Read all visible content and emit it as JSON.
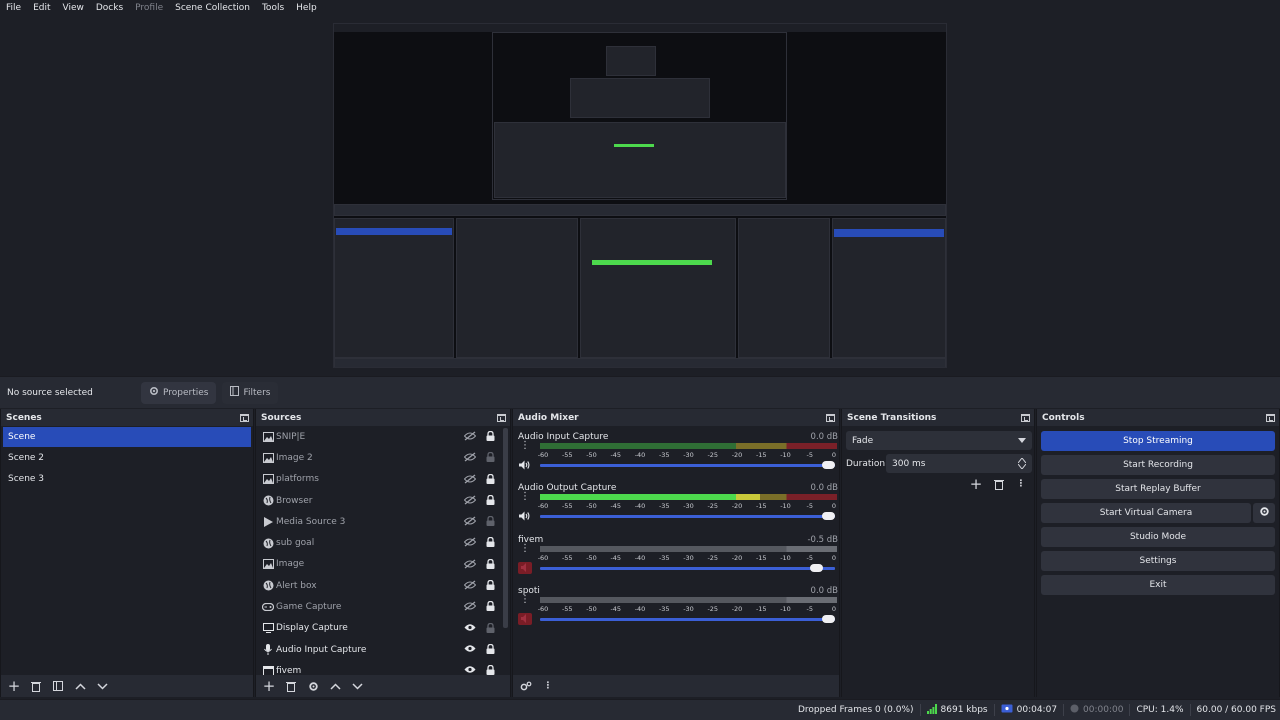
{
  "menu": [
    "File",
    "Edit",
    "View",
    "Docks",
    "Profile",
    "Scene Collection",
    "Tools",
    "Help"
  ],
  "menu_disabled": [
    "Profile"
  ],
  "context": {
    "no_source": "No source selected",
    "properties": "Properties",
    "filters": "Filters"
  },
  "scenes": {
    "title": "Scenes",
    "items": [
      "Scene",
      "Scene 2",
      "Scene 3"
    ],
    "selected": 0
  },
  "sources": {
    "title": "Sources",
    "items": [
      {
        "label": "SNIP|E",
        "icon": "image-icon",
        "visible": false,
        "locked": true
      },
      {
        "label": "Image 2",
        "icon": "image-icon",
        "visible": false,
        "locked": false
      },
      {
        "label": "platforms",
        "icon": "image-icon",
        "visible": false,
        "locked": true
      },
      {
        "label": "Browser",
        "icon": "globe-icon",
        "visible": false,
        "locked": true
      },
      {
        "label": "Media Source 3",
        "icon": "play-icon",
        "visible": false,
        "locked": false
      },
      {
        "label": "sub goal",
        "icon": "globe-icon",
        "visible": false,
        "locked": true
      },
      {
        "label": "Image",
        "icon": "image-icon",
        "visible": false,
        "locked": true
      },
      {
        "label": "Alert box",
        "icon": "globe-icon",
        "visible": false,
        "locked": true
      },
      {
        "label": "Game Capture",
        "icon": "gamepad-icon",
        "visible": false,
        "locked": true
      },
      {
        "label": "Display Capture",
        "icon": "monitor-icon",
        "visible": true,
        "locked": false
      },
      {
        "label": "Audio Input Capture",
        "icon": "microphone-icon",
        "visible": true,
        "locked": true
      },
      {
        "label": "fivem",
        "icon": "window-icon",
        "visible": true,
        "locked": true
      }
    ]
  },
  "mixer": {
    "title": "Audio Mixer",
    "tick_labels": [
      "-60",
      "-55",
      "-50",
      "-45",
      "-40",
      "-35",
      "-30",
      "-25",
      "-20",
      "-15",
      "-10",
      "-5",
      "0"
    ],
    "channels": [
      {
        "name": "Audio Input Capture",
        "db": "0.0 dB",
        "level": 0.0,
        "volume": 1.0,
        "muted": false
      },
      {
        "name": "Audio Output Capture",
        "db": "0.0 dB",
        "level": 0.74,
        "volume": 1.0,
        "muted": false
      },
      {
        "name": "fivem",
        "db": "-0.5 dB",
        "level": 0.0,
        "volume": 0.96,
        "muted": true
      },
      {
        "name": "spoti",
        "db": "0.0 dB",
        "level": 0.0,
        "volume": 1.0,
        "muted": true
      }
    ]
  },
  "transitions": {
    "title": "Scene Transitions",
    "selected": "Fade",
    "duration_label": "Duration",
    "duration": "300 ms"
  },
  "controls": {
    "title": "Controls",
    "stop_streaming": "Stop Streaming",
    "start_recording": "Start Recording",
    "start_replay": "Start Replay Buffer",
    "start_virtual": "Start Virtual Camera",
    "studio_mode": "Studio Mode",
    "settings": "Settings",
    "exit": "Exit"
  },
  "status": {
    "dropped": "Dropped Frames 0 (0.0%)",
    "kbps": "8691 kbps",
    "stream_time": "00:04:07",
    "rec_time": "00:00:00",
    "cpu": "CPU: 1.4%",
    "fps": "60.00 / 60.00 FPS"
  },
  "colors": {
    "accent": "#284cb8",
    "meter_green": "#4dd94d",
    "meter_yellow": "#c9c93a",
    "meter_red": "#d04040",
    "mute_red": "#7a1d26"
  }
}
